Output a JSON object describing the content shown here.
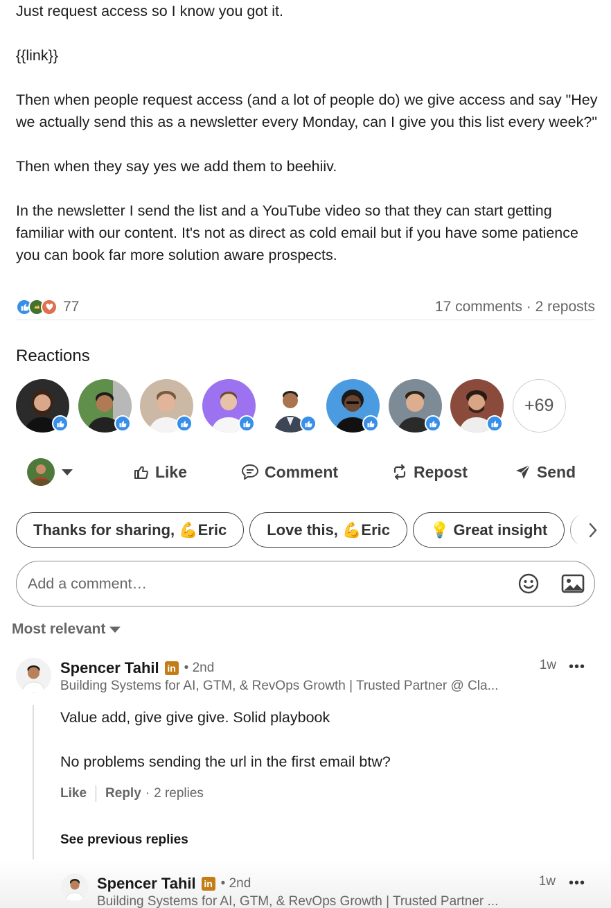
{
  "post": {
    "paragraphs": [
      "Just request access so I know you got it.",
      "{{link}}",
      "Then when people request access (and a lot of people do) we give access and say \"Hey we actually send this as a newsletter every Monday, can I give you this list every week?\"",
      "Then when they say yes we add them to beehiiv.",
      "In the newsletter I send the list and a YouTube video so that they can start getting familiar with our content. It's not as direct as cold email but if you have some patience you can book far more solution aware prospects."
    ]
  },
  "social": {
    "reaction_count": "77",
    "counts_text": "17 comments · 2 reposts",
    "reaction_icons": [
      "like-icon",
      "support-icon",
      "love-icon"
    ]
  },
  "reactions": {
    "title": "Reactions",
    "more_label": "+69",
    "avatars": [
      {
        "bg": "#2b2b2b",
        "skin": "#d9a88a",
        "hair": "#3a2418"
      },
      {
        "bg": "#5f8f4a",
        "skin": "#b07a55",
        "hair": "#1d1d1d"
      },
      {
        "bg": "#cbb9a6",
        "skin": "#e2b49a",
        "hair": "#7a5a3c"
      },
      {
        "bg": "#9c72f0",
        "skin": "#e8c2a8",
        "hair": "#6b4a2e"
      },
      {
        "bg": "#ffffff",
        "skin": "#a9744f",
        "hair": "#222222"
      },
      {
        "bg": "#4a9be0",
        "skin": "#6b4530",
        "hair": "#1a1a1a"
      },
      {
        "bg": "#7d8b96",
        "skin": "#dcae8f",
        "hair": "#2e2218"
      },
      {
        "bg": "#8a4b3c",
        "skin": "#d9a585",
        "hair": "#2a1c14"
      }
    ]
  },
  "actions": {
    "like": "Like",
    "comment": "Comment",
    "repost": "Repost",
    "send": "Send"
  },
  "chips": [
    {
      "label": "Thanks for sharing, 💪Eric"
    },
    {
      "label": "Love this, 💪Eric"
    },
    {
      "label": "💡 Great insight"
    }
  ],
  "comment_box": {
    "placeholder": "Add a comment…"
  },
  "sort": {
    "label": "Most relevant"
  },
  "comment": {
    "author": "Spencer Tahil",
    "degree": "• 2nd",
    "time": "1w",
    "headline": "Building Systems for AI, GTM, & RevOps Growth | Trusted Partner @ Cla...",
    "lines": [
      "Value add, give give give. Solid playbook",
      "No problems sending the url in the first email btw?"
    ],
    "like": "Like",
    "reply": "Reply",
    "replies": "2 replies",
    "see_previous": "See previous replies"
  },
  "reply": {
    "author": "Spencer Tahil",
    "degree": "• 2nd",
    "time": "1w",
    "headline": "Building Systems for AI, GTM, & RevOps Growth | Trusted Partner ..."
  },
  "colors": {
    "like_blue": "#378fe9",
    "linkedin_badge": "#c37d16",
    "muted_text": "#666666"
  }
}
